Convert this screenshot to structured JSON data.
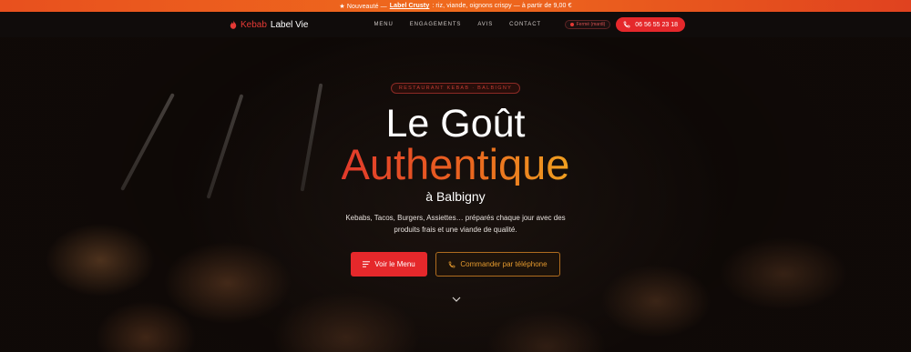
{
  "announcement": {
    "prefix": "★ Nouveauté —",
    "link": "Label Crusty",
    "suffix": ": riz, viande, oignons crispy — à partir de 9,00 €"
  },
  "nav": {
    "brand_red": "Kebab",
    "brand_white": "Label Vie",
    "menu": [
      "MENU",
      "ENGAGEMENTS",
      "AVIS",
      "CONTACT"
    ],
    "status": "Fermé (mardi)",
    "phone": "06 56 55 23 18"
  },
  "hero": {
    "badge": "RESTAURANT KEBAB · BALBIGNY",
    "title_line1": "Le Goût",
    "title_line2": "Authentique",
    "subtitle": "à Balbigny",
    "description": "Kebabs, Tacos, Burgers, Assiettes… préparés chaque jour avec des produits frais et une viande de qualité.",
    "cta_menu": "Voir le Menu",
    "cta_call": "Commander par téléphone"
  },
  "colors": {
    "accent": "#e5282b",
    "announcement_bar": "#ef6a1d",
    "gradient_end": "#f0a020",
    "outline_gold": "#e59a2e"
  },
  "icons": [
    "flame-icon",
    "phone-icon",
    "menu-lines-icon",
    "phone-outline-icon",
    "chevron-down-icon"
  ]
}
